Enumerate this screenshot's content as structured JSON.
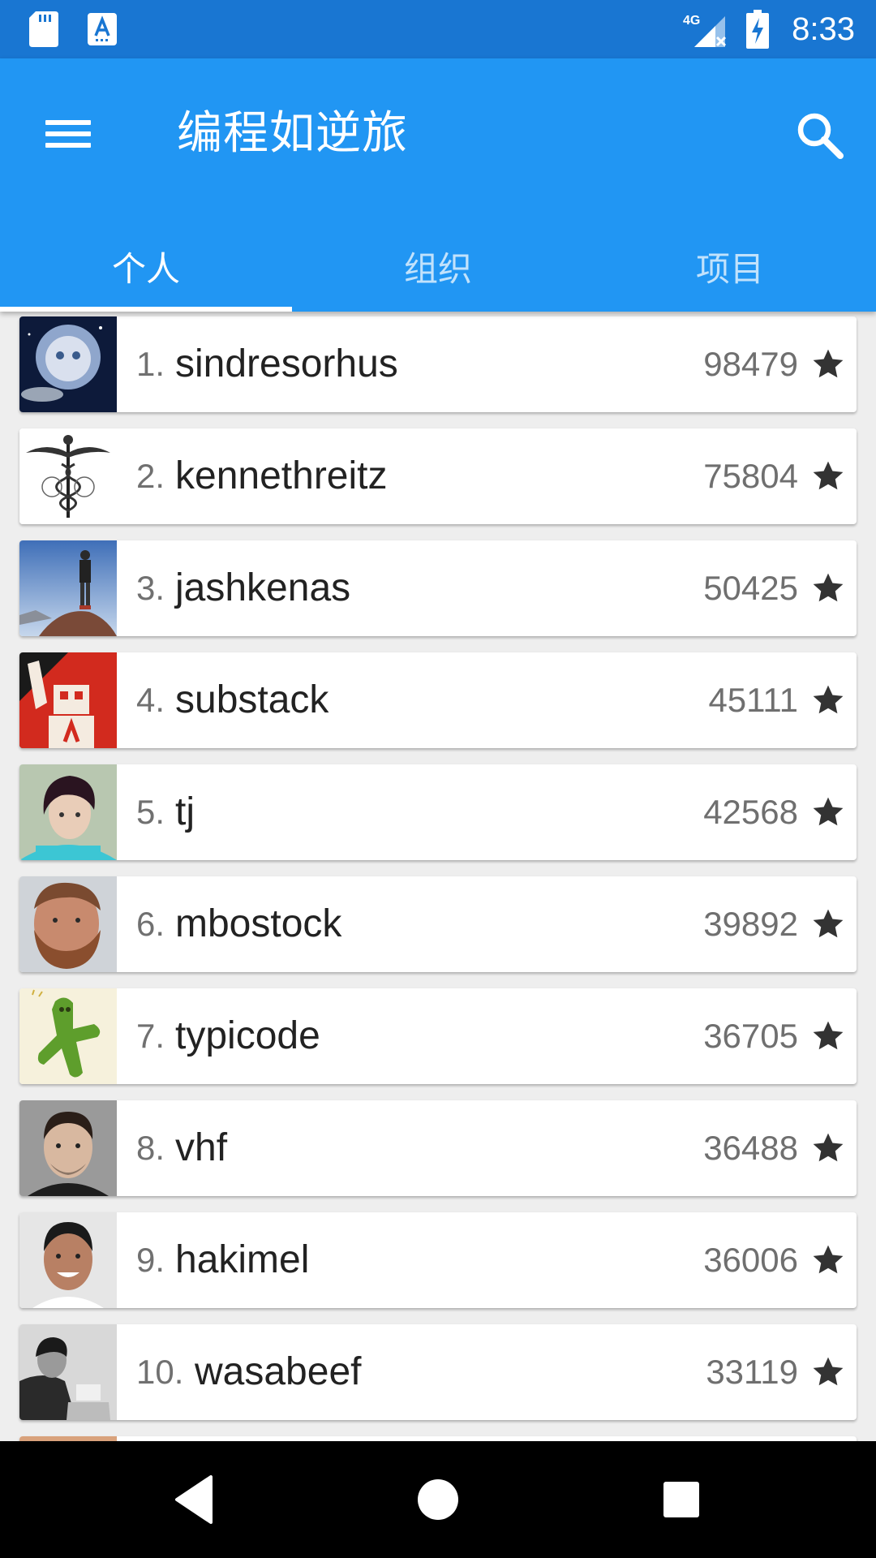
{
  "status_bar": {
    "time": "8:33",
    "network": "4G",
    "icons": [
      "sd-card-icon",
      "a-notification-icon",
      "signal-4g-icon",
      "battery-charging-icon"
    ]
  },
  "app_bar": {
    "title": "编程如逆旅",
    "menu_icon": "hamburger-menu-icon",
    "search_icon": "search-icon",
    "tabs": [
      {
        "label": "个人",
        "active": true
      },
      {
        "label": "组织",
        "active": false
      },
      {
        "label": "项目",
        "active": false
      }
    ]
  },
  "users": [
    {
      "rank": "1.",
      "name": "sindresorhus",
      "stars": "98479"
    },
    {
      "rank": "2.",
      "name": "kennethreitz",
      "stars": "75804"
    },
    {
      "rank": "3.",
      "name": "jashkenas",
      "stars": "50425"
    },
    {
      "rank": "4.",
      "name": "substack",
      "stars": "45111"
    },
    {
      "rank": "5.",
      "name": "tj",
      "stars": "42568"
    },
    {
      "rank": "6.",
      "name": "mbostock",
      "stars": "39892"
    },
    {
      "rank": "7.",
      "name": "typicode",
      "stars": "36705"
    },
    {
      "rank": "8.",
      "name": "vhf",
      "stars": "36488"
    },
    {
      "rank": "9.",
      "name": "hakimel",
      "stars": "36006"
    },
    {
      "rank": "10.",
      "name": "wasabeef",
      "stars": "33119"
    }
  ],
  "nav_bar": {
    "icons": [
      "back-triangle-icon",
      "home-circle-icon",
      "recents-square-icon"
    ]
  },
  "colors": {
    "status_bar": "#1976d2",
    "primary": "#2196f3",
    "background": "#eeeeee"
  }
}
